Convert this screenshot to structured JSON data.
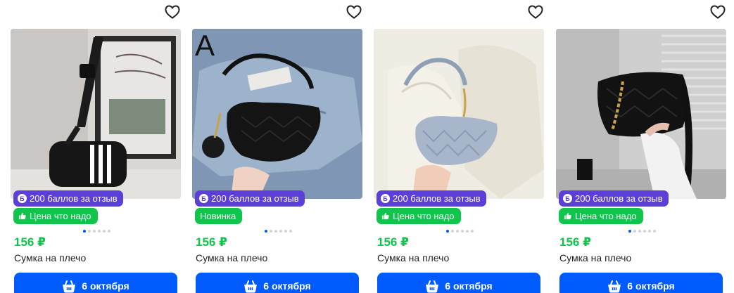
{
  "products": [
    {
      "points_badge": "200 баллов за отзыв",
      "points_icon": "Б",
      "tag": "Цена что надо",
      "tag_icon": "thumbs-up-icon",
      "price": "156 ₽",
      "title": "Сумка на плечо",
      "delivery": "6 октября",
      "photo_caption": "",
      "active_dot": 1
    },
    {
      "points_badge": "200 баллов за отзыв",
      "points_icon": "Б",
      "tag": "Новинка",
      "tag_icon": "",
      "price": "156 ₽",
      "title": "Сумка на плечо",
      "delivery": "6 октября",
      "photo_caption": "A",
      "active_dot": 1
    },
    {
      "points_badge": "200 баллов за отзыв",
      "points_icon": "Б",
      "tag": "Цена что надо",
      "tag_icon": "thumbs-up-icon",
      "price": "156 ₽",
      "title": "Сумка на плечо",
      "delivery": "6 октября",
      "photo_caption": "",
      "active_dot": 1
    },
    {
      "points_badge": "200 баллов за отзыв",
      "points_icon": "Б",
      "tag": "Цена что надо",
      "tag_icon": "thumbs-up-icon",
      "price": "156 ₽",
      "title": "Сумка на плечо",
      "delivery": "6 октября",
      "photo_caption": "",
      "active_dot": 1
    }
  ],
  "colors": {
    "brand_blue": "#005bff",
    "price_green": "#10c44c",
    "points_purple": "#5b3fd8"
  },
  "icons": {
    "favorite": "heart-outline-icon",
    "cart": "basket-icon"
  }
}
